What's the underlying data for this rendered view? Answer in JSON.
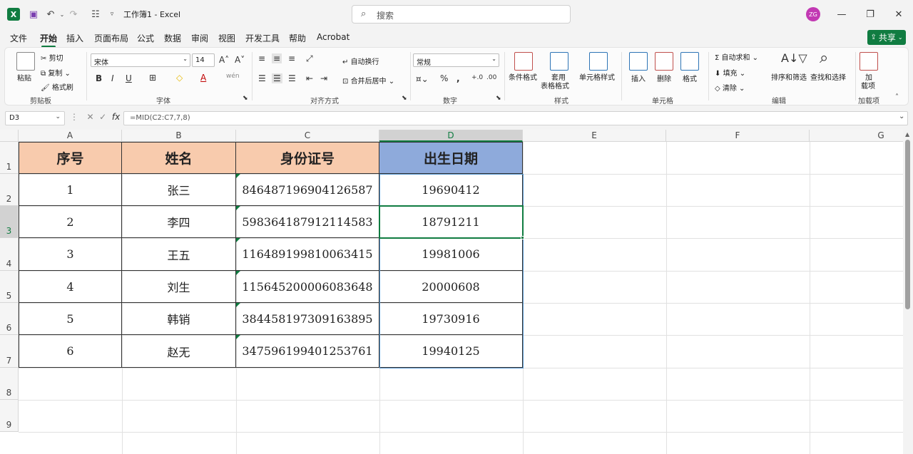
{
  "titlebar": {
    "doc_title": "工作簿1 - Excel",
    "search_placeholder": "搜索",
    "avatar_initials": "ZG",
    "minimize": "—",
    "restore": "❐",
    "close": "✕"
  },
  "menu": {
    "tabs": [
      "文件",
      "开始",
      "插入",
      "页面布局",
      "公式",
      "数据",
      "审阅",
      "视图",
      "开发工具",
      "帮助",
      "Acrobat"
    ],
    "active": "开始",
    "share": "共享"
  },
  "ribbon": {
    "clipboard": {
      "label": "剪贴板",
      "paste": "粘贴",
      "cut": "剪切",
      "copy": "复制",
      "format_painter": "格式刷"
    },
    "font": {
      "label": "字体",
      "font_name": "宋体",
      "font_size": "14"
    },
    "alignment": {
      "label": "对齐方式",
      "wrap_text": "自动换行",
      "merge_center": "合并后居中"
    },
    "number": {
      "label": "数字",
      "format": "常规"
    },
    "styles": {
      "label": "样式",
      "conditional": "条件格式",
      "table_line1": "套用",
      "table_line2": "表格格式",
      "cell_styles": "单元格样式"
    },
    "cells": {
      "label": "单元格",
      "insert": "插入",
      "delete": "删除",
      "format": "格式"
    },
    "editing": {
      "label": "编辑",
      "autosum": "自动求和",
      "fill": "填充",
      "clear": "清除",
      "sort_filter": "排序和筛选",
      "find_select": "查找和选择"
    },
    "addins": {
      "label": "加载项",
      "line1": "加",
      "line2": "载项"
    }
  },
  "formula_bar": {
    "name_box": "D3",
    "formula": "=MID(C2:C7,7,8)"
  },
  "sheet": {
    "columns": [
      "A",
      "B",
      "C",
      "D",
      "E",
      "F",
      "G"
    ],
    "rows": [
      "1",
      "2",
      "3",
      "4",
      "5",
      "6",
      "7",
      "8",
      "9"
    ],
    "header": [
      "序号",
      "姓名",
      "身份证号",
      "出生日期"
    ],
    "data": [
      [
        "1",
        "张三",
        "846487196904126587",
        "19690412"
      ],
      [
        "2",
        "李四",
        "598364187912114583",
        "18791211"
      ],
      [
        "3",
        "王五",
        "116489199810063415",
        "19981006"
      ],
      [
        "4",
        "刘生",
        "115645200006083648",
        "20000608"
      ],
      [
        "5",
        "韩销",
        "384458197309163895",
        "19730916"
      ],
      [
        "6",
        "赵无",
        "347596199401253761",
        "19940125"
      ]
    ],
    "selected_cell": "D3",
    "header_colors": {
      "abc": "#f8cbad",
      "d": "#8eaadb"
    }
  }
}
